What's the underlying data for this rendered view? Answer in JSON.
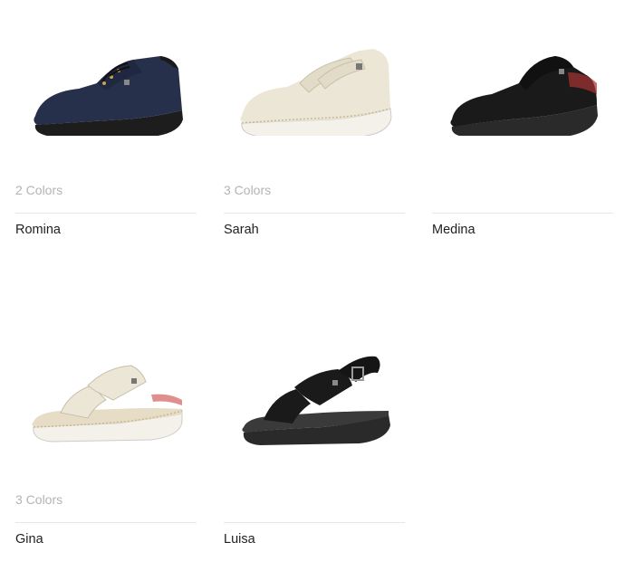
{
  "products": [
    {
      "name": "Romina",
      "colors": "2 Colors",
      "icon": "navy-lace-up-shoe"
    },
    {
      "name": "Sarah",
      "colors": "3 Colors",
      "icon": "cream-velcro-shoe"
    },
    {
      "name": "Medina",
      "colors": "",
      "icon": "black-clog"
    },
    {
      "name": "Gina",
      "colors": "3 Colors",
      "icon": "cream-velcro-sandal"
    },
    {
      "name": "Luisa",
      "colors": "",
      "icon": "black-strap-sandal"
    }
  ],
  "palette": {
    "navy": "#26304a",
    "cream": "#ece6d7",
    "black": "#1a1a1a",
    "sole_dark": "#2a2a2a",
    "sole_light": "#f3f1ea"
  }
}
